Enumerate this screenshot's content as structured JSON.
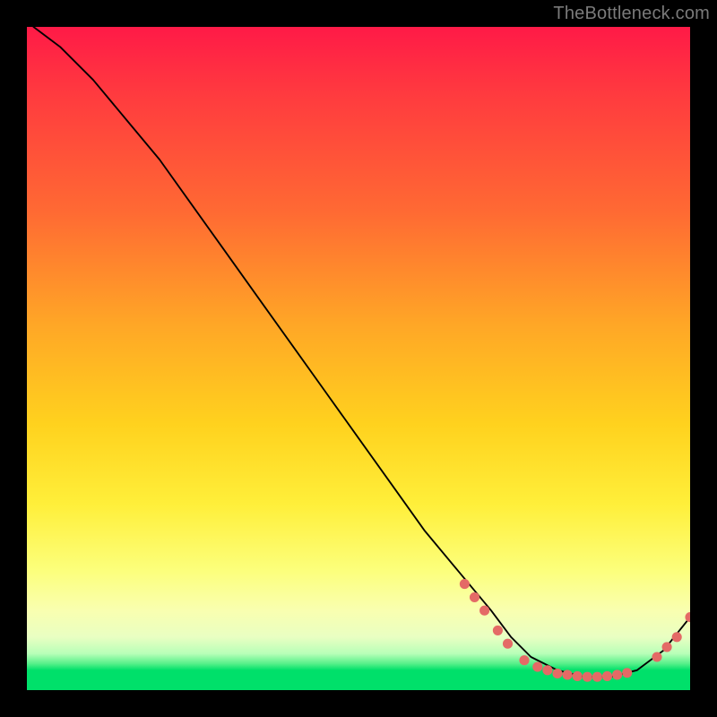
{
  "watermark": "TheBottleneck.com",
  "chart_data": {
    "type": "line",
    "title": "",
    "xlabel": "",
    "ylabel": "",
    "xlim": [
      0,
      100
    ],
    "ylim": [
      0,
      100
    ],
    "grid": false,
    "legend": false,
    "annotations": [],
    "series": [
      {
        "name": "bottleneck-curve",
        "x": [
          1,
          5,
          10,
          15,
          20,
          25,
          30,
          35,
          40,
          45,
          50,
          55,
          60,
          65,
          70,
          73,
          76,
          80,
          84,
          88,
          92,
          96,
          100
        ],
        "y": [
          100,
          97,
          92,
          86,
          80,
          73,
          66,
          59,
          52,
          45,
          38,
          31,
          24,
          18,
          12,
          8,
          5,
          3,
          2,
          2,
          3,
          6,
          11
        ]
      }
    ],
    "markers": [
      {
        "name": "highlight-dots",
        "color": "#e46a66",
        "points": [
          {
            "x": 66,
            "y": 16
          },
          {
            "x": 67.5,
            "y": 14
          },
          {
            "x": 69,
            "y": 12
          },
          {
            "x": 71,
            "y": 9
          },
          {
            "x": 72.5,
            "y": 7
          },
          {
            "x": 75,
            "y": 4.5
          },
          {
            "x": 77,
            "y": 3.5
          },
          {
            "x": 78.5,
            "y": 3
          },
          {
            "x": 80,
            "y": 2.5
          },
          {
            "x": 81.5,
            "y": 2.3
          },
          {
            "x": 83,
            "y": 2.1
          },
          {
            "x": 84.5,
            "y": 2
          },
          {
            "x": 86,
            "y": 2
          },
          {
            "x": 87.5,
            "y": 2.1
          },
          {
            "x": 89,
            "y": 2.3
          },
          {
            "x": 90.5,
            "y": 2.6
          },
          {
            "x": 95,
            "y": 5
          },
          {
            "x": 96.5,
            "y": 6.5
          },
          {
            "x": 98,
            "y": 8
          },
          {
            "x": 100,
            "y": 11
          }
        ]
      }
    ]
  }
}
